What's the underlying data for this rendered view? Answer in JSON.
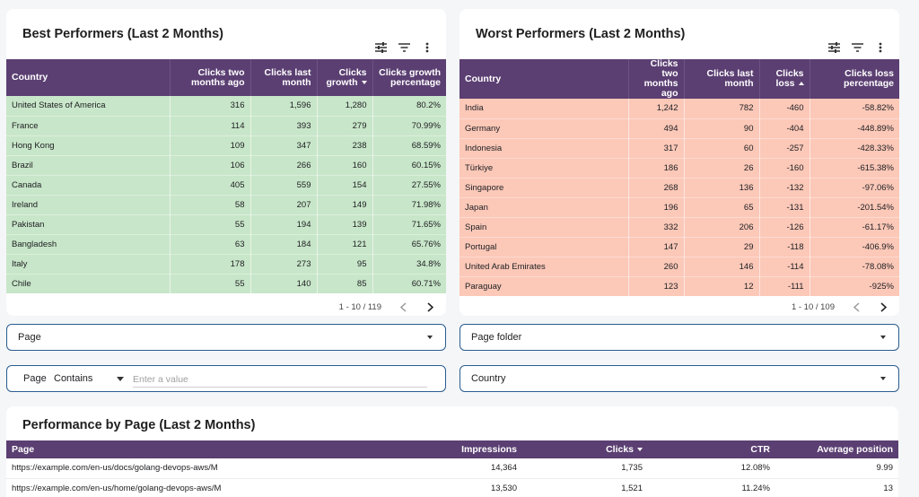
{
  "best": {
    "title": "Best Performers (Last 2 Months)",
    "columns": [
      "Country",
      "Clicks two months ago",
      "Clicks last month",
      "Clicks growth",
      "Clicks growth percentage"
    ],
    "rows": [
      [
        "United States of America",
        "316",
        "1,596",
        "1,280",
        "80.2%"
      ],
      [
        "France",
        "114",
        "393",
        "279",
        "70.99%"
      ],
      [
        "Hong Kong",
        "109",
        "347",
        "238",
        "68.59%"
      ],
      [
        "Brazil",
        "106",
        "266",
        "160",
        "60.15%"
      ],
      [
        "Canada",
        "405",
        "559",
        "154",
        "27.55%"
      ],
      [
        "Ireland",
        "58",
        "207",
        "149",
        "71.98%"
      ],
      [
        "Pakistan",
        "55",
        "194",
        "139",
        "71.65%"
      ],
      [
        "Bangladesh",
        "63",
        "184",
        "121",
        "65.76%"
      ],
      [
        "Italy",
        "178",
        "273",
        "95",
        "34.8%"
      ],
      [
        "Chile",
        "55",
        "140",
        "85",
        "60.71%"
      ]
    ],
    "pagination": "1 - 10 / 119"
  },
  "worst": {
    "title": "Worst Performers (Last 2 Months)",
    "columns": [
      "Country",
      "Clicks two months ago",
      "Clicks last month",
      "Clicks loss",
      "Clicks loss percentage"
    ],
    "rows": [
      [
        "India",
        "1,242",
        "782",
        "-460",
        "-58.82%"
      ],
      [
        "Germany",
        "494",
        "90",
        "-404",
        "-448.89%"
      ],
      [
        "Indonesia",
        "317",
        "60",
        "-257",
        "-428.33%"
      ],
      [
        "Türkiye",
        "186",
        "26",
        "-160",
        "-615.38%"
      ],
      [
        "Singapore",
        "268",
        "136",
        "-132",
        "-97.06%"
      ],
      [
        "Japan",
        "196",
        "65",
        "-131",
        "-201.54%"
      ],
      [
        "Spain",
        "332",
        "206",
        "-126",
        "-61.17%"
      ],
      [
        "Portugal",
        "147",
        "29",
        "-118",
        "-406.9%"
      ],
      [
        "United Arab Emirates",
        "260",
        "146",
        "-114",
        "-78.08%"
      ],
      [
        "Paraguay",
        "123",
        "12",
        "-111",
        "-925%"
      ]
    ],
    "pagination": "1 - 10 / 109"
  },
  "filters": {
    "page_label": "Page",
    "page_folder_label": "Page folder",
    "country_label": "Country",
    "page_contains": {
      "field": "Page",
      "operator": "Contains",
      "placeholder": "Enter a value"
    }
  },
  "pages": {
    "title": "Performance by Page (Last 2 Months)",
    "columns": [
      "Page",
      "Impressions",
      "Clicks",
      "CTR",
      "Average position"
    ],
    "rows": [
      [
        "https://example.com/en-us/docs/golang-devops-aws/M",
        "14,364",
        "1,735",
        "12.08%",
        "9.99"
      ],
      [
        "https://example.com/en-us/home/golang-devops-aws/M",
        "13,530",
        "1,521",
        "11.24%",
        "13"
      ]
    ]
  },
  "colors": {
    "header": "#5b3f72",
    "best_rows": "#c8e6c9",
    "worst_rows": "#fcc8b8",
    "filter_border": "#2a5d8f"
  }
}
